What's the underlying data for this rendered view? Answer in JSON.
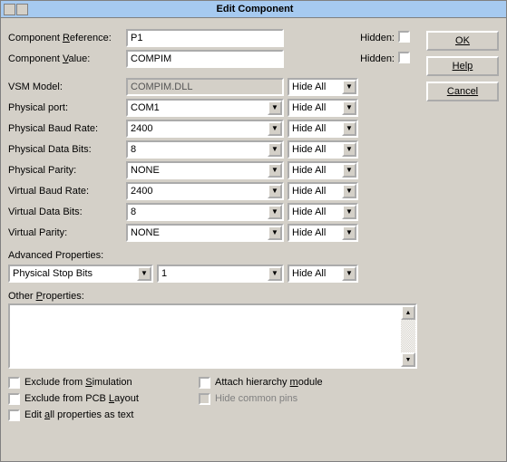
{
  "title": "Edit Component",
  "buttons": {
    "ok": "OK",
    "help": "Help",
    "cancel": "Cancel"
  },
  "labels": {
    "compRef": "Component Reference:",
    "compVal": "Component Value:",
    "vsm": "VSM Model:",
    "physPort": "Physical port:",
    "physBaud": "Physical Baud Rate:",
    "physData": "Physical Data Bits:",
    "physParity": "Physical Parity:",
    "virtBaud": "Virtual Baud Rate:",
    "virtData": "Virtual Data Bits:",
    "virtParity": "Virtual Parity:",
    "advProps": "Advanced Properties:",
    "otherProps": "Other Properties:",
    "hidden": "Hidden:",
    "hideAll": "Hide All",
    "exclSim": "Exclude from Simulation",
    "exclPcb": "Exclude from PCB Layout",
    "editAll": "Edit all properties as text",
    "attachHier": "Attach hierarchy module",
    "hideCommon": "Hide common pins"
  },
  "fields": {
    "compRef": "P1",
    "compVal": "COMPIM",
    "vsm": "COMPIM.DLL",
    "physPort": "COM1",
    "physBaud": "2400",
    "physData": "8",
    "physParity": "NONE",
    "virtBaud": "2400",
    "virtData": "8",
    "virtParity": "NONE",
    "advPropName": "Physical Stop Bits",
    "advPropVal": "1",
    "otherProps": ""
  }
}
